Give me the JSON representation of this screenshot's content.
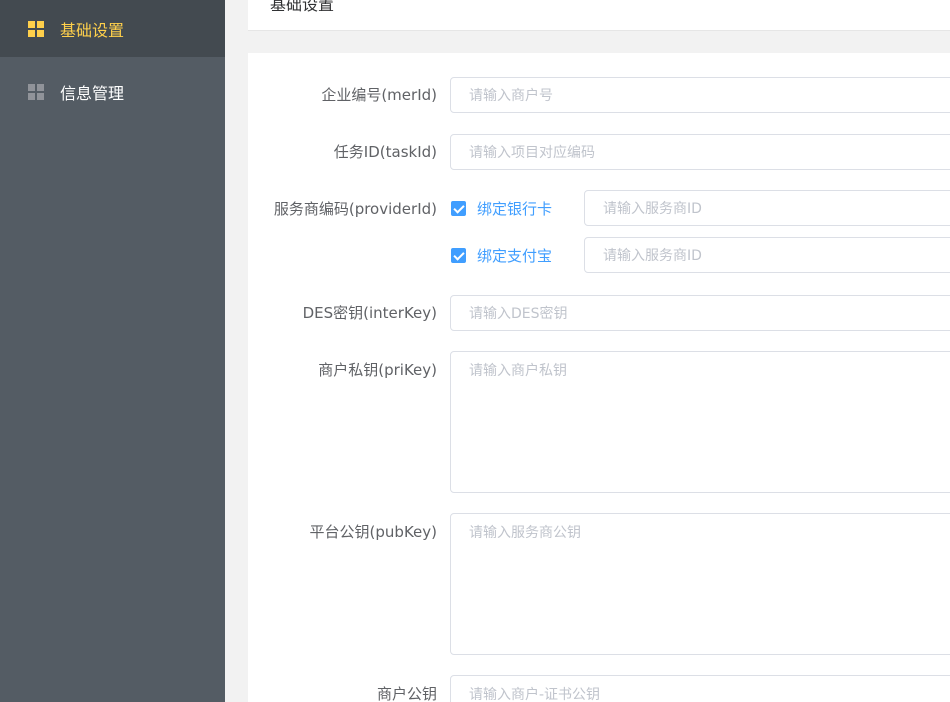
{
  "sidebar": {
    "items": [
      {
        "label": "基础设置",
        "icon": "grid-icon",
        "active": true
      },
      {
        "label": "信息管理",
        "icon": "grid-icon",
        "active": false
      }
    ],
    "background": "#545c64",
    "active_color": "#ffd04b"
  },
  "header": {
    "title": "基础设置"
  },
  "form": {
    "merId": {
      "label": "企业编号(merId)",
      "placeholder": "请输入商户号"
    },
    "taskId": {
      "label": "任务ID(taskId)",
      "placeholder": "请输入项目对应编码"
    },
    "providerId": {
      "label": "服务商编码(providerId)",
      "options": [
        {
          "label": "绑定银行卡",
          "checked": true,
          "placeholder": "请输入服务商ID"
        },
        {
          "label": "绑定支付宝",
          "checked": true,
          "placeholder": "请输入服务商ID"
        }
      ]
    },
    "interKey": {
      "label": "DES密钥(interKey)",
      "placeholder": "请输入DES密钥"
    },
    "priKey": {
      "label": "商户私钥(priKey)",
      "placeholder": "请输入商户私钥"
    },
    "pubKey": {
      "label": "平台公钥(pubKey)",
      "placeholder": "请输入服务商公钥"
    },
    "merPubKey": {
      "label": "商户公钥",
      "placeholder": "请输入商户-证书公钥"
    }
  },
  "colors": {
    "accent": "#409eff",
    "border": "#dcdfe6",
    "placeholder": "#c0c4cc"
  }
}
